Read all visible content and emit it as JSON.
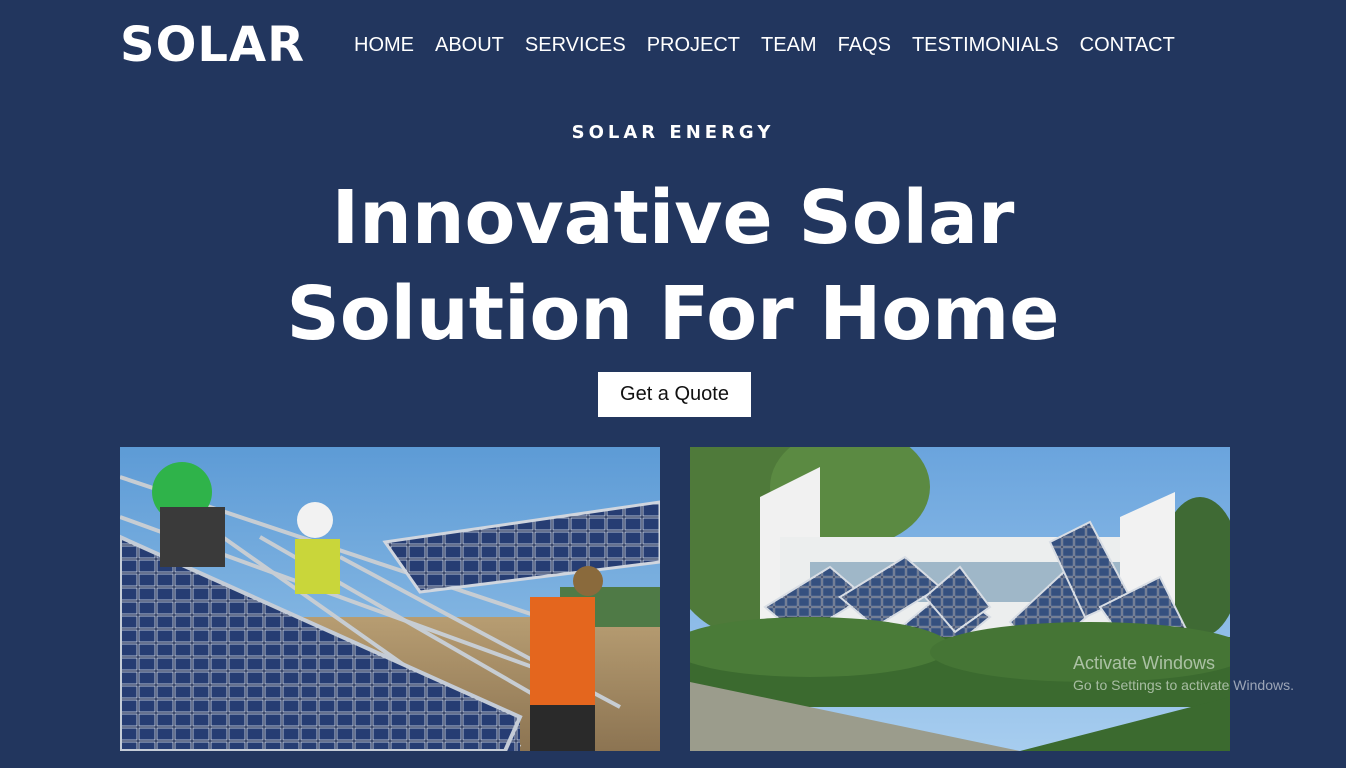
{
  "header": {
    "logo": "SOLAR",
    "nav": [
      "HOME",
      "ABOUT",
      "SERVICES",
      "PROJECT",
      "TEAM",
      "FAQS",
      "TESTIMONIALS",
      "CONTACT"
    ]
  },
  "hero": {
    "eyebrow": "SOLAR ENERGY",
    "headline_line1": "Innovative Solar",
    "headline_line2": "Solution For Home",
    "cta_label": "Get a Quote"
  },
  "gallery": {
    "image1": "workers-installing-solar-panels",
    "image2": "building-with-solar-panel-arrays"
  },
  "os_watermark": {
    "title": "Activate Windows",
    "subtitle": "Go to Settings to activate Windows."
  },
  "colors": {
    "background": "#22365e",
    "text": "#ffffff",
    "button_bg": "#ffffff",
    "button_text": "#111111"
  }
}
